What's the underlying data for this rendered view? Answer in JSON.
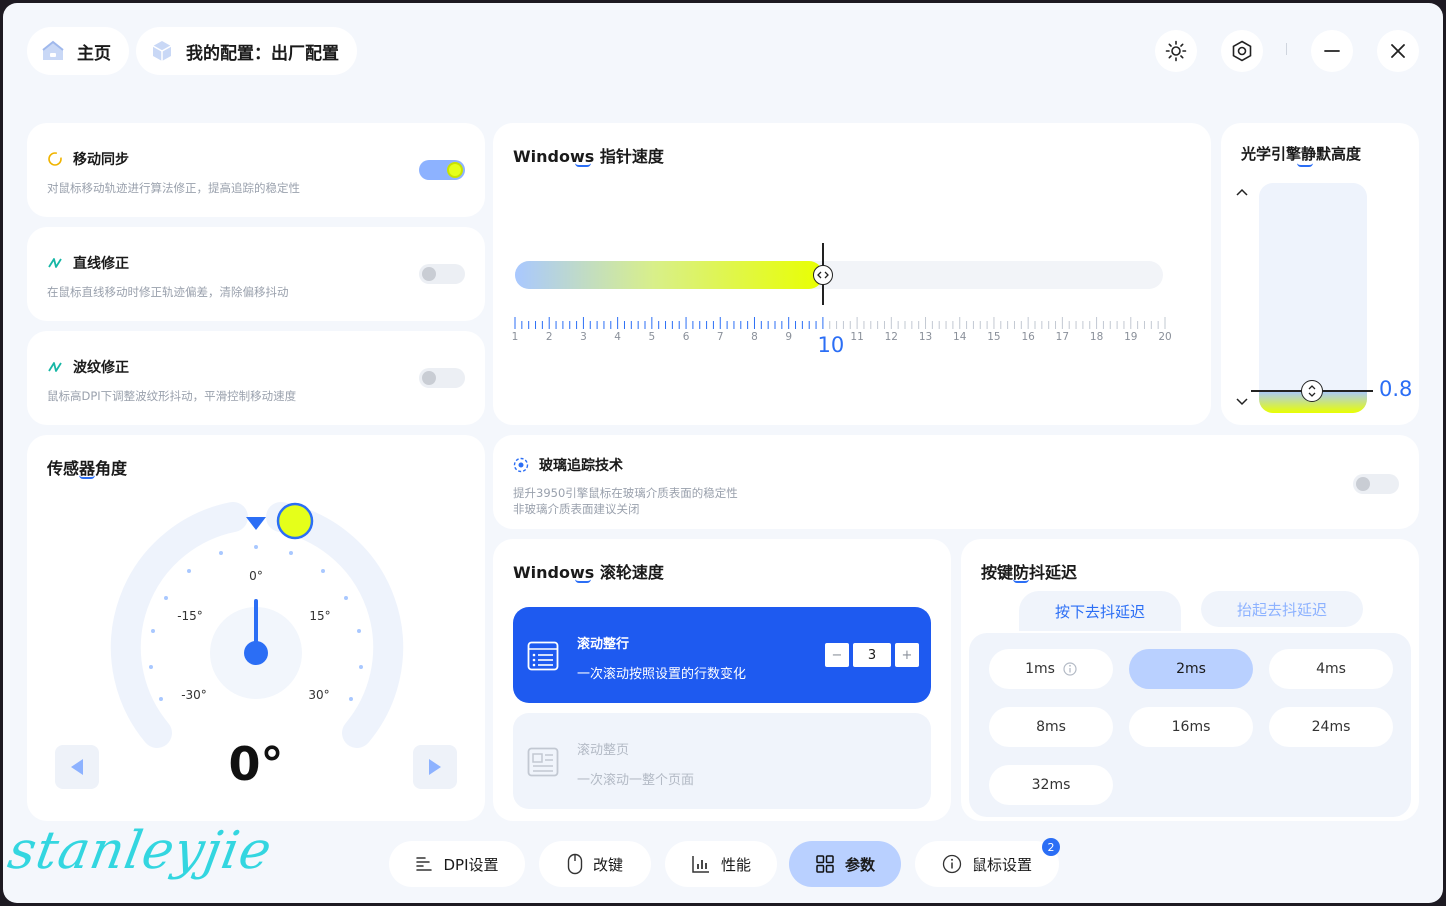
{
  "header": {
    "home_label": "主页",
    "profile_label": "我的配置：出厂配置",
    "icons": [
      "home-icon",
      "cube-icon",
      "brightness-icon",
      "settings-hex-icon",
      "minimize-icon",
      "close-icon"
    ]
  },
  "features": [
    {
      "title": "移动同步",
      "desc": "对鼠标移动轨迹进行算法修正，提高追踪的稳定性",
      "enabled": true,
      "icon": "circle-sync-icon"
    },
    {
      "title": "直线修正",
      "desc": "在鼠标直线移动时修正轨迹偏差，清除偏移抖动",
      "enabled": false,
      "icon": "line-correct-icon"
    },
    {
      "title": "波纹修正",
      "desc": "鼠标高DPI下调整波纹形抖动，平滑控制移动速度",
      "enabled": false,
      "icon": "ripple-correct-icon"
    }
  ],
  "pointer_speed": {
    "title": "Windows 指针速度",
    "value": 10,
    "value_label": "10",
    "min": 1,
    "max": 20,
    "ticks": [
      "1",
      "2",
      "3",
      "4",
      "5",
      "6",
      "7",
      "8",
      "9",
      "11",
      "12",
      "13",
      "14",
      "15",
      "16",
      "17",
      "18",
      "19",
      "20"
    ]
  },
  "lod": {
    "title": "光学引擎静默高度",
    "value": 0.8,
    "value_label": "0.8",
    "level_fraction": 0.1
  },
  "sensor_angle": {
    "title": "传感器角度",
    "value": 0,
    "value_label": "0°",
    "labels": {
      "zero": "0°",
      "neg15": "-15°",
      "pos15": "15°",
      "neg30": "-30°",
      "pos30": "30°"
    }
  },
  "glass": {
    "title": "玻璃追踪技术",
    "desc1": "提升3950引擎鼠标在玻璃介质表面的稳定性",
    "desc2": "非玻璃介质表面建议关闭",
    "enabled": false
  },
  "scroll": {
    "title": "Windows 滚轮速度",
    "line_title": "滚动整行",
    "line_desc": "一次滚动按照设置的行数变化",
    "line_value": "3",
    "minus": "−",
    "plus": "+",
    "page_title": "滚动整页",
    "page_desc": "一次滚动一整个页面"
  },
  "debounce": {
    "title": "按键防抖延迟",
    "tab_press": "按下去抖延迟",
    "tab_release": "抬起去抖延迟",
    "selected": "2ms",
    "options": [
      "1ms",
      "2ms",
      "4ms",
      "8ms",
      "16ms",
      "24ms",
      "32ms"
    ]
  },
  "nav": {
    "items": [
      "DPI设置",
      "改键",
      "性能",
      "参数",
      "鼠标设置"
    ],
    "active": "参数",
    "badge": "2"
  },
  "watermark": "stanleyjie",
  "colors": {
    "accent": "#2b6ef5",
    "highlight": "#e5ff1a",
    "selected_chip": "#b9d0ff"
  }
}
